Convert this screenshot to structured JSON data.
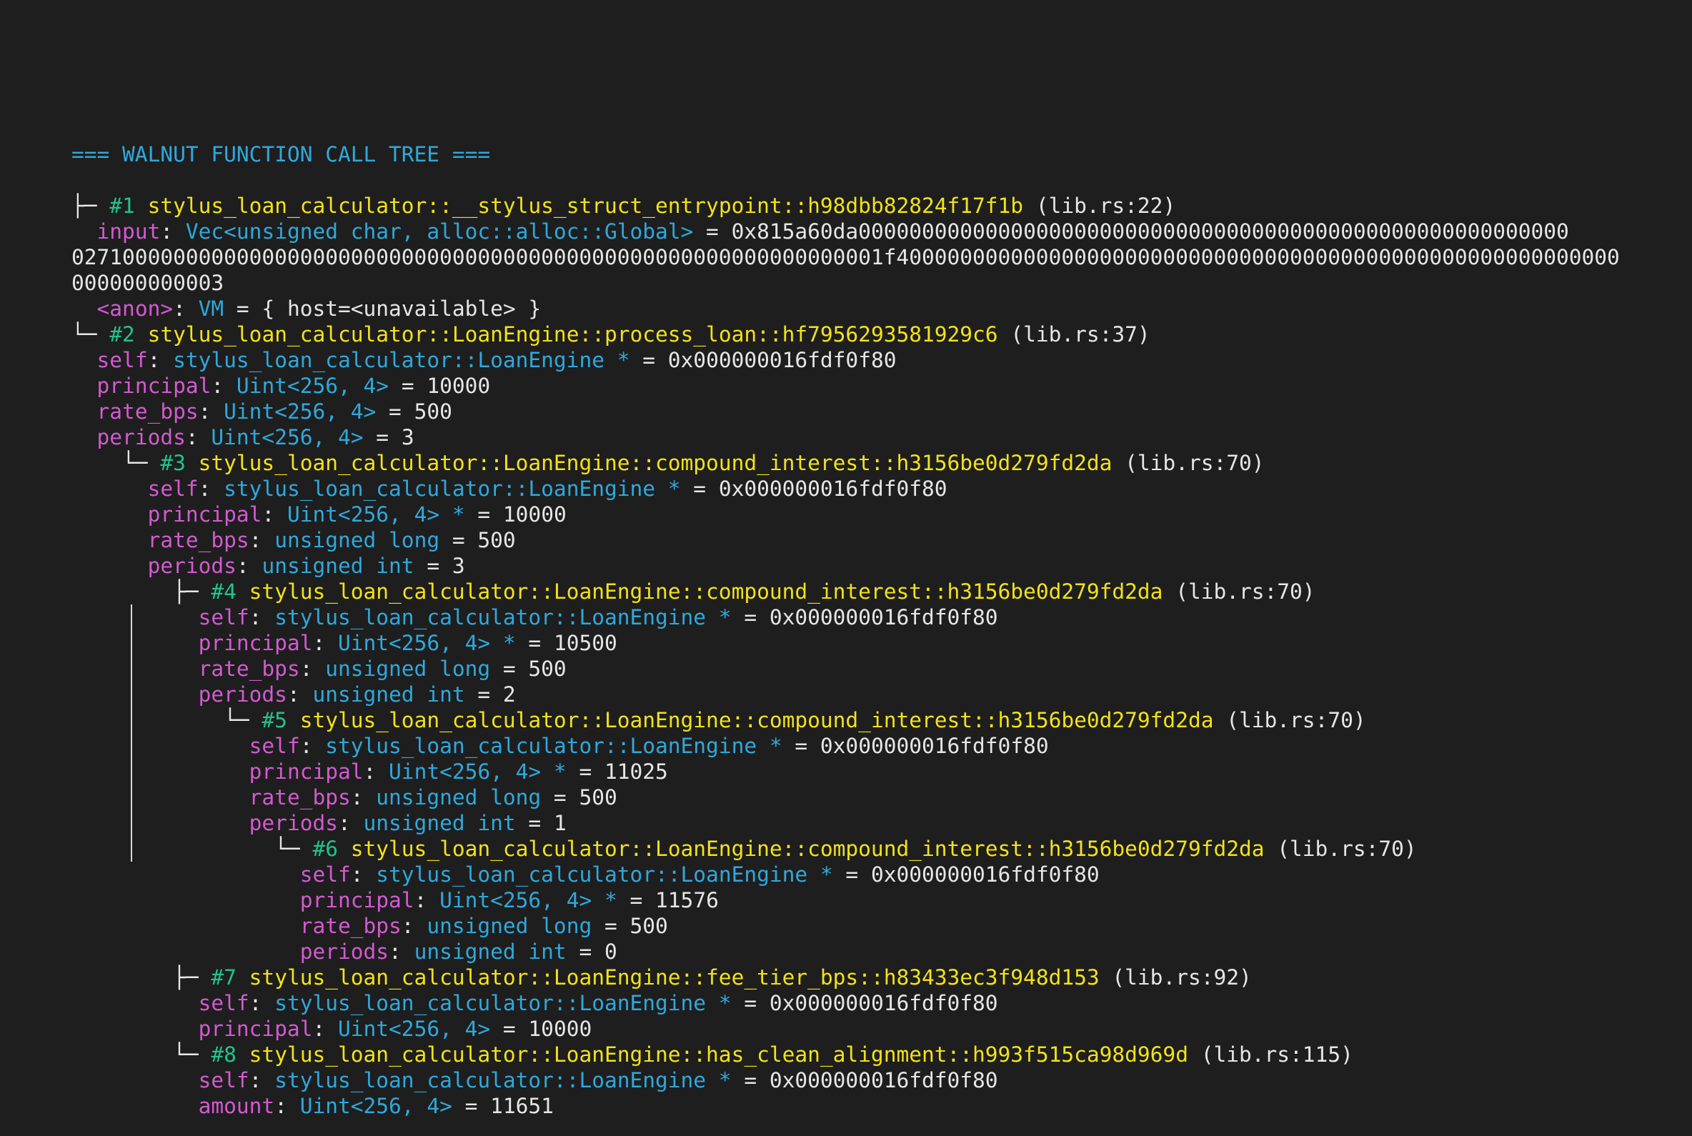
{
  "header": "=== WALNUT FUNCTION CALL TREE ===",
  "frames": [
    {
      "prefix": "├─ ",
      "indent": "",
      "num": "#1",
      "func": "stylus_loan_calculator::__stylus_struct_entrypoint::h98dbb82824f17f1b",
      "loc": "(lib.rs:22)",
      "arg_indent": "  ",
      "args": [
        {
          "name": "input",
          "type": "Vec<unsigned char, alloc::alloc::Global>",
          "value": "0x815a60da00000000000000000000000000000000000000000000000000000000"
        },
        {
          "cont": "0271000000000000000000000000000000000000000000000000000000000001f400000000000000000000000000000000000000000000000000000000"
        },
        {
          "cont": "000000000003"
        },
        {
          "name": "<anon>",
          "type": "VM",
          "value": "{ host=<unavailable> }"
        }
      ]
    },
    {
      "prefix": "└─ ",
      "indent": "",
      "num": "#2",
      "func": "stylus_loan_calculator::LoanEngine::process_loan::hf7956293581929c6",
      "loc": "(lib.rs:37)",
      "arg_indent": "  ",
      "args": [
        {
          "name": "self",
          "type": "stylus_loan_calculator::LoanEngine *",
          "value": "0x000000016fdf0f80"
        },
        {
          "name": "principal",
          "type": "Uint<256, 4>",
          "value": "10000"
        },
        {
          "name": "rate_bps",
          "type": "Uint<256, 4>",
          "value": "500"
        },
        {
          "name": "periods",
          "type": "Uint<256, 4>",
          "value": "3"
        }
      ]
    },
    {
      "prefix": "└─ ",
      "indent": "    ",
      "num": "#3",
      "func": "stylus_loan_calculator::LoanEngine::compound_interest::h3156be0d279fd2da",
      "loc": "(lib.rs:70)",
      "arg_indent": "      ",
      "args": [
        {
          "name": "self",
          "type": "stylus_loan_calculator::LoanEngine *",
          "value": "0x000000016fdf0f80"
        },
        {
          "name": "principal",
          "type": "Uint<256, 4> *",
          "value": "10000"
        },
        {
          "name": "rate_bps",
          "type": "unsigned long",
          "value": "500"
        },
        {
          "name": "periods",
          "type": "unsigned int",
          "value": "3"
        }
      ]
    },
    {
      "prefix": "├─ ",
      "indent": "        ",
      "num": "#4",
      "func": "stylus_loan_calculator::LoanEngine::compound_interest::h3156be0d279fd2da",
      "loc": "(lib.rs:70)",
      "arg_indent": "          ",
      "args": [
        {
          "name": "self",
          "type": "stylus_loan_calculator::LoanEngine *",
          "value": "0x000000016fdf0f80"
        },
        {
          "name": "principal",
          "type": "Uint<256, 4> *",
          "value": "10500"
        },
        {
          "name": "rate_bps",
          "type": "unsigned long",
          "value": "500"
        },
        {
          "name": "periods",
          "type": "unsigned int",
          "value": "2"
        }
      ]
    },
    {
      "prefix": "└─ ",
      "indent": "            ",
      "num": "#5",
      "func": "stylus_loan_calculator::LoanEngine::compound_interest::h3156be0d279fd2da",
      "loc": "(lib.rs:70)",
      "arg_indent": "              ",
      "args": [
        {
          "name": "self",
          "type": "stylus_loan_calculator::LoanEngine *",
          "value": "0x000000016fdf0f80"
        },
        {
          "name": "principal",
          "type": "Uint<256, 4> *",
          "value": "11025"
        },
        {
          "name": "rate_bps",
          "type": "unsigned long",
          "value": "500"
        },
        {
          "name": "periods",
          "type": "unsigned int",
          "value": "1"
        }
      ]
    },
    {
      "prefix": "└─ ",
      "indent": "                ",
      "num": "#6",
      "func": "stylus_loan_calculator::LoanEngine::compound_interest::h3156be0d279fd2da",
      "loc": "(lib.rs:70)",
      "arg_indent": "                  ",
      "args": [
        {
          "name": "self",
          "type": "stylus_loan_calculator::LoanEngine *",
          "value": "0x000000016fdf0f80"
        },
        {
          "name": "principal",
          "type": "Uint<256, 4> *",
          "value": "11576"
        },
        {
          "name": "rate_bps",
          "type": "unsigned long",
          "value": "500"
        },
        {
          "name": "periods",
          "type": "unsigned int",
          "value": "0"
        }
      ]
    },
    {
      "prefix": "├─ ",
      "indent": "        ",
      "num": "#7",
      "func": "stylus_loan_calculator::LoanEngine::fee_tier_bps::h83433ec3f948d153",
      "loc": "(lib.rs:92)",
      "arg_indent": "          ",
      "args": [
        {
          "name": "self",
          "type": "stylus_loan_calculator::LoanEngine *",
          "value": "0x000000016fdf0f80"
        },
        {
          "name": "principal",
          "type": "Uint<256, 4>",
          "value": "10000"
        }
      ]
    },
    {
      "prefix": "└─ ",
      "indent": "        ",
      "num": "#8",
      "func": "stylus_loan_calculator::LoanEngine::has_clean_alignment::h993f515ca98d969d",
      "loc": "(lib.rs:115)",
      "arg_indent": "          ",
      "args": [
        {
          "name": "self",
          "type": "stylus_loan_calculator::LoanEngine *",
          "value": "0x000000016fdf0f80"
        },
        {
          "name": "amount",
          "type": "Uint<256, 4>",
          "value": "11651"
        }
      ]
    }
  ]
}
